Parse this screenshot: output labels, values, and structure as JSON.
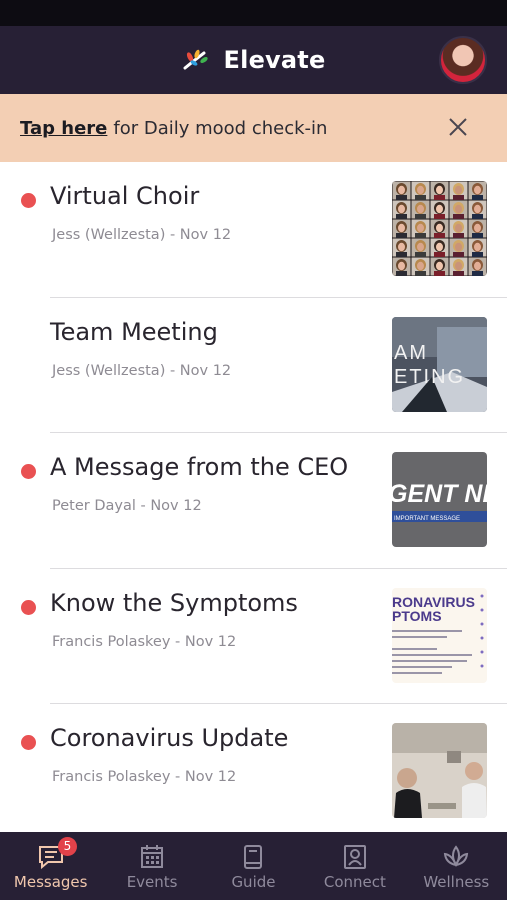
{
  "header": {
    "title": "Elevate",
    "logo_icon": "elevate-sprout-logo"
  },
  "banner": {
    "link": "Tap here",
    "text": "for Daily mood check-in",
    "close_icon": "close-icon"
  },
  "messages": [
    {
      "title": "Virtual Choir",
      "meta": "Jess (Wellzesta) - Nov 12",
      "unread": true,
      "thumb": "choir-grid"
    },
    {
      "title": "Team Meeting",
      "meta": "Jess (Wellzesta) - Nov 12",
      "unread": false,
      "thumb": "team-meeting",
      "thumb_text": [
        "AM",
        "ETING"
      ]
    },
    {
      "title": "A Message from the CEO",
      "meta": "Peter Dayal - Nov 12",
      "unread": true,
      "thumb": "urgent-news",
      "thumb_text": [
        "GENT NEW",
        "IMPORTANT MESSAGE"
      ]
    },
    {
      "title": "Know the Symptoms",
      "meta": "Francis Polaskey - Nov 12",
      "unread": true,
      "thumb": "symptoms",
      "thumb_text": [
        "RONAVIRUS",
        "PTOMS"
      ]
    },
    {
      "title": "Coronavirus Update",
      "meta": "Francis Polaskey - Nov 12",
      "unread": true,
      "thumb": "video-call"
    }
  ],
  "tabs": [
    {
      "label": "Messages",
      "icon": "message-icon",
      "active": true,
      "badge": "5"
    },
    {
      "label": "Events",
      "icon": "calendar-icon",
      "active": false
    },
    {
      "label": "Guide",
      "icon": "book-icon",
      "active": false
    },
    {
      "label": "Connect",
      "icon": "contact-card-icon",
      "active": false
    },
    {
      "label": "Wellness",
      "icon": "lotus-icon",
      "active": false
    }
  ],
  "colors": {
    "header_bg": "#272035",
    "banner_bg": "#f3cfb4",
    "unread_dot": "#e95152",
    "active_tab": "#f0c7ad"
  }
}
